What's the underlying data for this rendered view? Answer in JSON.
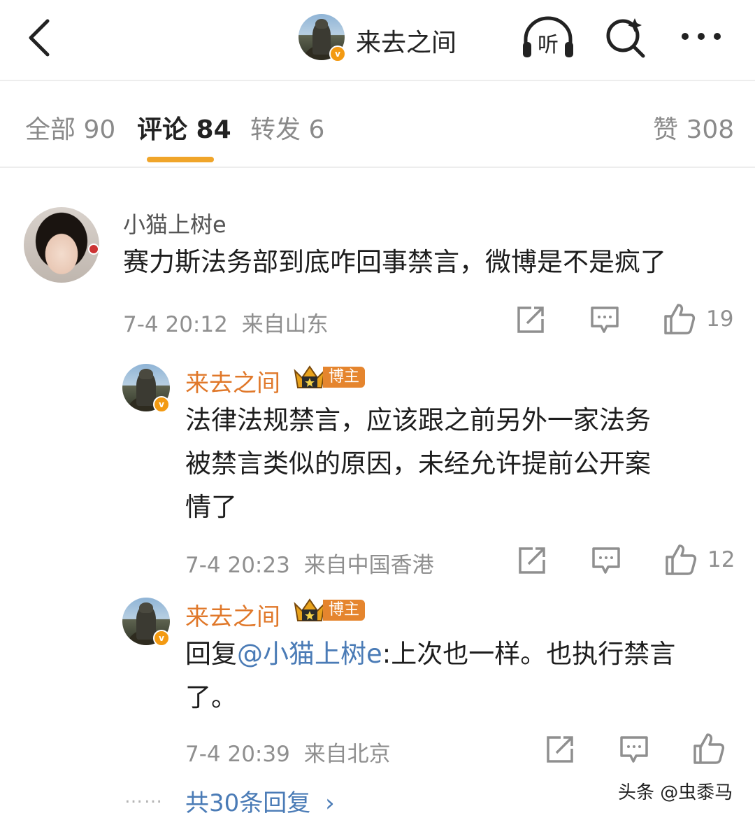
{
  "header": {
    "title": "来去之间"
  },
  "tabs": [
    {
      "label": "全部 90"
    },
    {
      "label": "评论 84"
    },
    {
      "label": "转发 6"
    },
    {
      "label": "赞 308"
    }
  ],
  "comments": [
    {
      "username": "小猫上树e",
      "text": "赛力斯法务部到底咋回事禁言，微博是不是疯了",
      "time": "7-4 20:12",
      "location": "来自山东",
      "likes": "19"
    },
    {
      "username": "来去之间",
      "badge": "博主",
      "text_lines": [
        "法律法规禁言，应该跟之前另外一家法务",
        "被禁言类似的原因，未经允许提前公开案",
        "情了"
      ],
      "time": "7-4 20:23",
      "location": "来自中国香港",
      "likes": "12"
    },
    {
      "username": "来去之间",
      "badge": "博主",
      "reply_prefix": "回复",
      "mention": "@小猫上树e",
      "text_rest": ":上次也一样。也执行禁言",
      "text_line2": "了。",
      "time": "7-4 20:39",
      "location": "来自北京"
    }
  ],
  "more_replies": {
    "dots": "……",
    "label": "共30条回复",
    "arrow": "›"
  },
  "watermark": "头条 @虫黍马",
  "icons": {
    "back": "chevron-left-icon",
    "listen": "headphones-icon",
    "listen_label": "听",
    "search": "search-icon",
    "more": "more-dots-icon",
    "share": "share-icon",
    "comment": "comment-icon",
    "like": "thumbs-up-icon"
  },
  "colors": {
    "accent": "#f0a52a",
    "author": "#e0782a",
    "link": "#4a7bb6"
  }
}
